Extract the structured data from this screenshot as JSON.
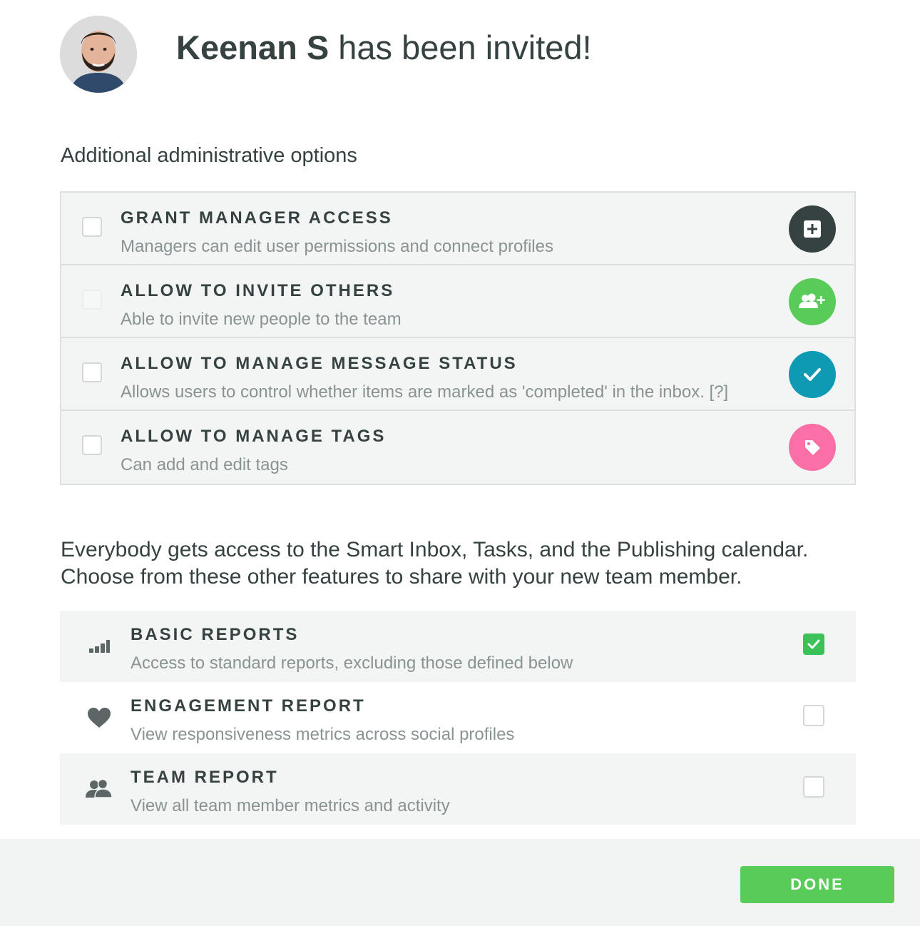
{
  "header": {
    "invitee_name": "Keenan S",
    "invited_text": " has been invited!"
  },
  "admin": {
    "section_label": "Additional administrative options",
    "options": [
      {
        "title": "GRANT MANAGER ACCESS",
        "description": "Managers can edit user permissions and connect profiles",
        "icon": "plus-square-icon",
        "color": "#364141",
        "checked": false
      },
      {
        "title": "ALLOW TO INVITE OTHERS",
        "description": "Able to invite new people to the team",
        "icon": "add-people-icon",
        "color": "#59cb59",
        "checked": false
      },
      {
        "title": "ALLOW TO MANAGE MESSAGE STATUS",
        "description": "Allows users to control whether items are marked as 'completed' in the inbox. [?]",
        "icon": "checkmark-icon",
        "color": "#0e9ab3",
        "checked": false
      },
      {
        "title": "ALLOW TO MANAGE TAGS",
        "description": "Can add and edit tags",
        "icon": "tag-icon",
        "color": "#f96fa6",
        "checked": false
      }
    ]
  },
  "features": {
    "intro_line1": "Everybody gets access to the Smart Inbox, Tasks, and the Publishing calendar.",
    "intro_line2": "Choose from these other features to share with your new team member.",
    "items": [
      {
        "title": "BASIC REPORTS",
        "description": "Access to standard reports, excluding those defined below",
        "icon": "bar-chart-icon",
        "checked": true
      },
      {
        "title": "ENGAGEMENT REPORT",
        "description": "View responsiveness metrics across social profiles",
        "icon": "heart-icon",
        "checked": false
      },
      {
        "title": "TEAM REPORT",
        "description": "View all team member metrics and activity",
        "icon": "team-icon",
        "checked": false
      }
    ]
  },
  "footer": {
    "done_label": "DONE"
  }
}
